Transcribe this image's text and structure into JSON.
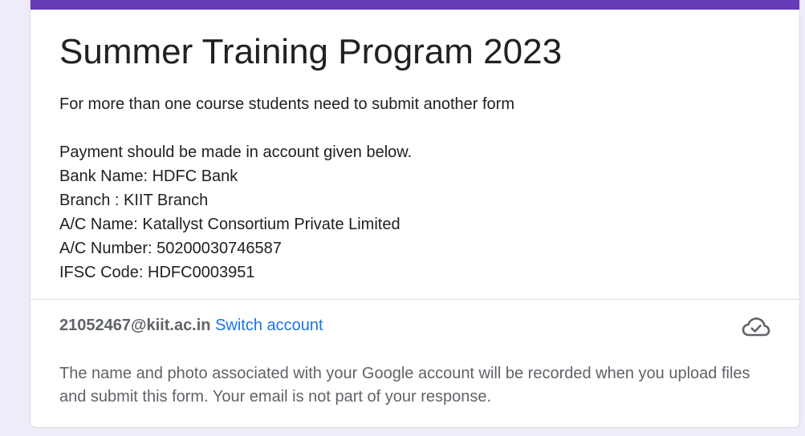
{
  "colors": {
    "accent": "#673ab7",
    "link": "#1a73e8",
    "background": "#efebf8"
  },
  "form": {
    "title": "Summer Training Program 2023",
    "description": {
      "intro": "For more than one course students need to submit another form",
      "payment_line": "Payment should be made in account given below.",
      "bank_name": "Bank Name: HDFC Bank",
      "branch": "Branch : KIIT Branch",
      "ac_name": "A/C Name: Katallyst Consortium Private Limited",
      "ac_number": "A/C Number: 50200030746587",
      "ifsc": "IFSC Code: HDFC0003951"
    }
  },
  "account": {
    "email": "21052467@kiit.ac.in",
    "switch_label": "Switch account",
    "save_icon": "cloud-check-icon",
    "notice": "The name and photo associated with your Google account will be recorded when you upload files and submit this form. Your email is not part of your response."
  }
}
